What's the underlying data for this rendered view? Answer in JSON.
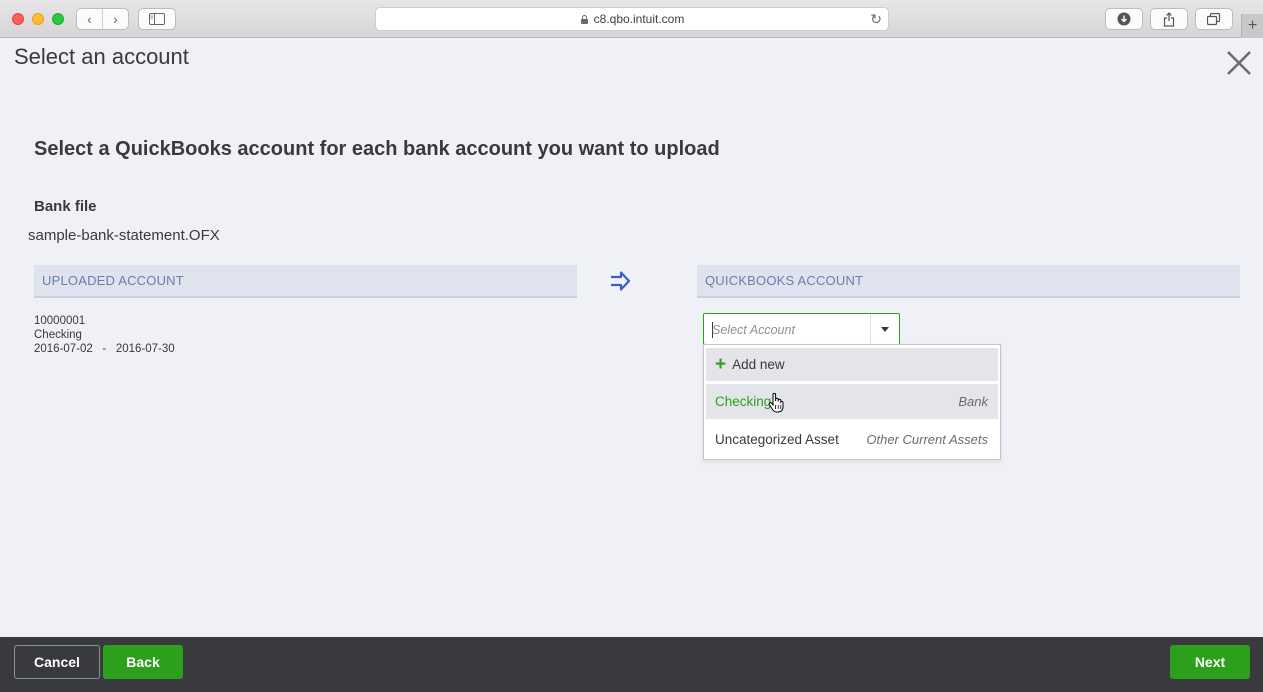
{
  "browser": {
    "url": "c8.qbo.intuit.com",
    "back_glyph": "‹",
    "forward_glyph": "›",
    "reload_glyph": "↻",
    "new_tab_glyph": "+"
  },
  "dialog": {
    "title": "Select an account",
    "subtitle": "Select a QuickBooks account for each bank account you want to upload",
    "bank_file_label": "Bank file",
    "bank_file_name": "sample-bank-statement.OFX"
  },
  "columns": {
    "uploaded": "UPLOADED ACCOUNT",
    "quickbooks": "QUICKBOOKS ACCOUNT"
  },
  "uploaded_account": {
    "number": "10000001",
    "type": "Checking",
    "date_range": "2016-07-02   -   2016-07-30"
  },
  "account_select": {
    "placeholder": "Select Account",
    "options": [
      {
        "name": "Add new",
        "type": ""
      },
      {
        "name": "Checking",
        "type": "Bank"
      },
      {
        "name": "Uncategorized Asset",
        "type": "Other Current Assets"
      }
    ]
  },
  "footer": {
    "cancel": "Cancel",
    "back": "Back",
    "next": "Next"
  },
  "colors": {
    "accent_green": "#2ca01c",
    "footer_bg": "#393a3d",
    "header_blue": "#6b7ea8"
  }
}
